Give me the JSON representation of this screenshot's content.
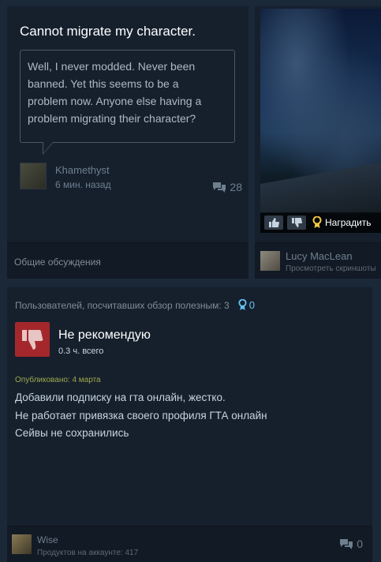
{
  "discussion": {
    "title": "Cannot migrate my character.",
    "body_lines": [
      "Well, I never modded. Never been",
      "banned. Yet this seems to be a",
      "problem now. Anyone else having a",
      "problem migrating their character?"
    ],
    "author": "Khamethyst",
    "time": "6 мин. назад",
    "comment_count": "28",
    "footer_label": "Общие обсуждения"
  },
  "screenshot": {
    "award_label": "Наградить",
    "author": "Lucy MacLean",
    "subtitle": "Просмотреть скриншоты"
  },
  "review": {
    "helpful_text": "Пользователей, посчитавших обзор полезным: 3",
    "award_count": "0",
    "verdict": "Не рекомендую",
    "hours": "0.3 ч. всего",
    "published": "Опубликовано: 4 марта",
    "body_lines": [
      "Добавили подписку на гта онлайн, жестко.",
      "Не работает привязка своего профиля ГТА онлайн",
      "Сейвы не сохранились"
    ],
    "author": "Wise",
    "products": "Продуктов на аккаунте: 417",
    "comment_count": "0"
  },
  "colors": {
    "background": "#1b2838",
    "card": "#16202d",
    "not_recommended": "#a4282b",
    "link_blue": "#66c0f4",
    "published_yellow": "#9fa84a"
  }
}
